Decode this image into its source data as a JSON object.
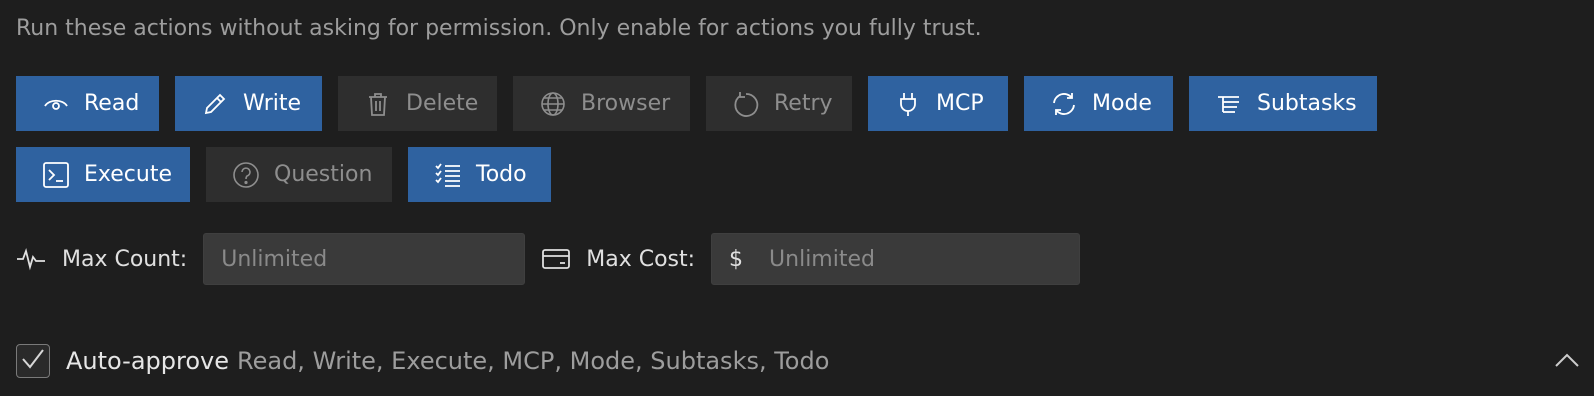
{
  "description": "Run these actions without asking for permission. Only enable for actions you fully trust.",
  "actions_row1": [
    {
      "label": "Read",
      "icon": "eye-icon",
      "enabled": true
    },
    {
      "label": "Write",
      "icon": "pencil-icon",
      "enabled": true
    },
    {
      "label": "Delete",
      "icon": "trash-icon",
      "enabled": false
    },
    {
      "label": "Browser",
      "icon": "globe-icon",
      "enabled": false
    },
    {
      "label": "Retry",
      "icon": "retry-icon",
      "enabled": false
    },
    {
      "label": "MCP",
      "icon": "plug-icon",
      "enabled": true
    },
    {
      "label": "Mode",
      "icon": "sync-icon",
      "enabled": true
    },
    {
      "label": "Subtasks",
      "icon": "subtasks-icon",
      "enabled": true
    }
  ],
  "actions_row2": [
    {
      "label": "Execute",
      "icon": "terminal-icon",
      "enabled": true
    },
    {
      "label": "Question",
      "icon": "question-icon",
      "enabled": false
    },
    {
      "label": "Todo",
      "icon": "checklist-icon",
      "enabled": true
    }
  ],
  "limits": {
    "max_count_label": "Max Count:",
    "max_count_placeholder": "Unlimited",
    "max_cost_label": "Max Cost:",
    "currency": "$",
    "max_cost_placeholder": "Unlimited"
  },
  "auto_approve": {
    "checked": true,
    "title": "Auto-approve",
    "summary": "Read, Write, Execute, MCP, Mode, Subtasks, Todo"
  },
  "colors": {
    "background": "#1e1e1e",
    "enabled_button": "#2f62a0",
    "disabled_button": "#2e2e2e",
    "input_background": "#3a3a3a"
  }
}
